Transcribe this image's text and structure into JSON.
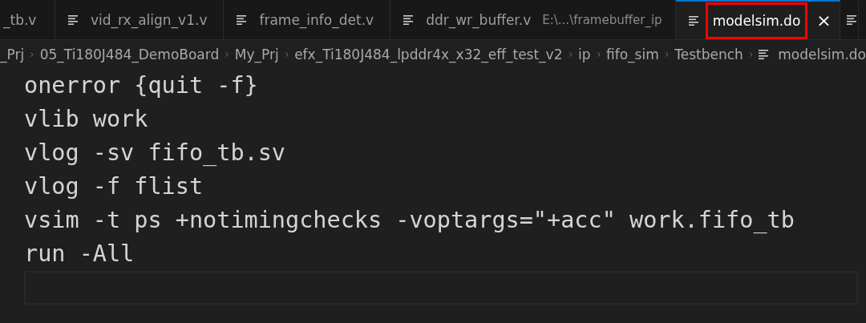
{
  "tabs": [
    {
      "kind": "cut",
      "label": "_tb.v",
      "selected": false
    },
    {
      "kind": "file",
      "label": "vid_rx_align_v1.v",
      "selected": false
    },
    {
      "kind": "file",
      "label": "frame_info_det.v",
      "selected": false
    },
    {
      "kind": "file",
      "label": "ddr_wr_buffer.v",
      "description": "E:\\...\\framebuffer_ip",
      "selected": false
    },
    {
      "kind": "file",
      "label": "modelsim.do",
      "selected": true,
      "annotated": true,
      "close": "×"
    },
    {
      "kind": "icon_only",
      "selected": false
    }
  ],
  "breadcrumb": [
    "_Prj",
    "05_Ti180J484_DemoBoard",
    "My_Prj",
    "efx_Ti180J484_lpddr4x_x32_eff_test_v2",
    "ip",
    "fifo_sim",
    "Testbench",
    "modelsim.do"
  ],
  "code_lines": [
    {
      "text": "onerror {quit -f}",
      "current": false
    },
    {
      "text": "vlib work",
      "current": false
    },
    {
      "text": "vlog -sv fifo_tb.sv",
      "current": false
    },
    {
      "text": "vlog -f flist",
      "current": false
    },
    {
      "text": "vsim -t ps +notimingchecks -voptargs=\"+acc\" work.fifo_tb",
      "current": false
    },
    {
      "text": "run -All",
      "current": false
    },
    {
      "current": true
    }
  ]
}
